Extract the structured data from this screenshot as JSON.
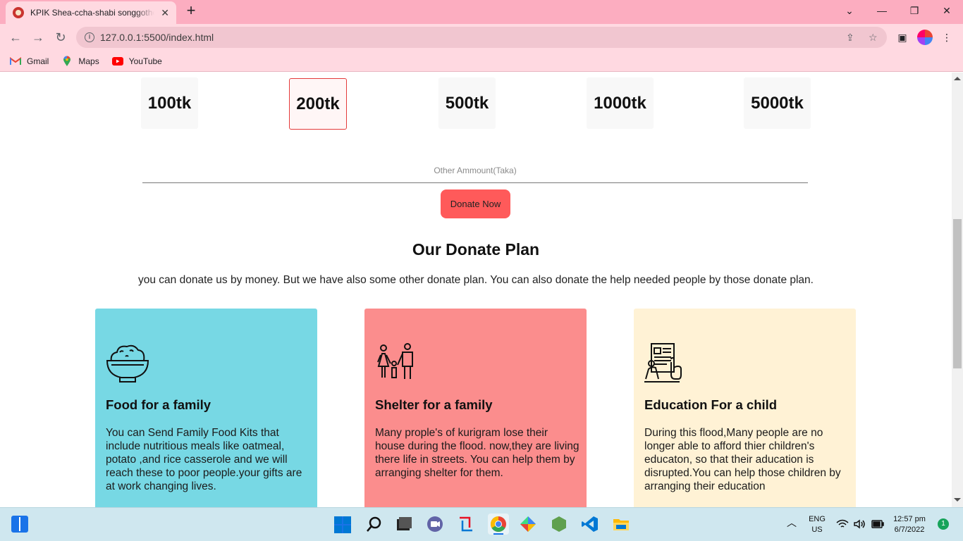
{
  "browser": {
    "tab_title": "KPIK Shea-ccha-shabi songgothon",
    "tab_close": "✕",
    "new_tab": "+",
    "url": "127.0.0.1:5500/index.html",
    "bookmarks": [
      {
        "label": "Gmail",
        "icon": "gmail-icon"
      },
      {
        "label": "Maps",
        "icon": "maps-icon"
      },
      {
        "label": "YouTube",
        "icon": "youtube-icon"
      }
    ]
  },
  "donation": {
    "amounts": [
      "100tk",
      "200tk",
      "500tk",
      "1000tk",
      "5000tk"
    ],
    "selected": "200tk",
    "other_placeholder": "Other Ammount(Taka)",
    "button_label": "Donate Now"
  },
  "plan": {
    "title": "Our Donate Plan",
    "description": "you can donate us by money. But we have also some other donate plan. You can also donate the help needed people by those donate plan.",
    "cards": [
      {
        "title": "Food for a family",
        "text": "You can Send Family Food Kits that include nutritious meals like oatmeal, potato ,and rice casserole and we will reach these to poor people.your gifts are at work changing lives.",
        "color": "#77d8e4",
        "icon": "food-bowl-icon"
      },
      {
        "title": "Shelter for a family",
        "text": "Many prople's of kurigram lose their house during the flood. now,they are living there life in streets. You can help them by arranging shelter for them.",
        "color": "#fb8d8d",
        "icon": "family-icon"
      },
      {
        "title": "Education For a child",
        "text": "During this flood,Many people are no longer able to afford thier children's educaton, so that their aducation is disrupted.You can help those children by arranging their education",
        "color": "#fff2d5",
        "icon": "education-icon"
      }
    ]
  },
  "taskbar": {
    "language": "ENG",
    "region": "US",
    "time": "12:57 pm",
    "date": "6/7/2022",
    "notifications": "1"
  }
}
